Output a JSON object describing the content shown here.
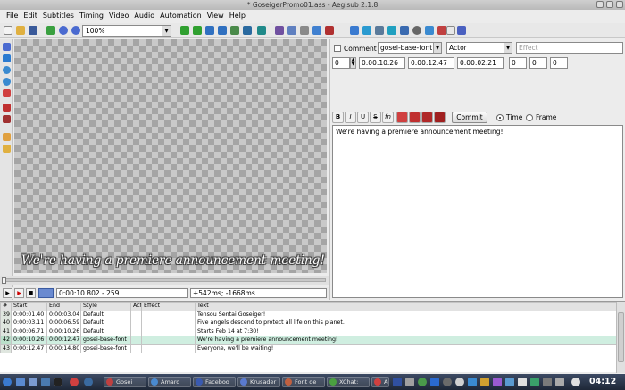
{
  "window": {
    "title": "* GoseigerPromo01.ass - Aegisub 2.1.8"
  },
  "menu": [
    "File",
    "Edit",
    "Subtitles",
    "Timing",
    "Video",
    "Audio",
    "Automation",
    "View",
    "Help"
  ],
  "toolbar": {
    "zoom_value": "100%"
  },
  "video": {
    "subtitle_text": "We're having a premiere announcement meeting!"
  },
  "video_controls": {
    "time_frame": "0:00:10.802 - 259",
    "offset": "+542ms; -1668ms"
  },
  "editor": {
    "comment_label": "Comment",
    "style": "gosei-base-font",
    "actor": "Actor",
    "effect_placeholder": "Effect",
    "layer": "0",
    "start": "0:00:10.26",
    "end": "0:00:12.47",
    "duration": "0:00:02.21",
    "margin_l": "0",
    "margin_r": "0",
    "margin_v": "0",
    "format_buttons": [
      "B",
      "I",
      "U",
      "S",
      "fn"
    ],
    "commit_label": "Commit",
    "time_label": "Time",
    "frame_label": "Frame",
    "text": "We're having a premiere announcement meeting!"
  },
  "grid": {
    "columns": [
      "#",
      "Start",
      "End",
      "Style",
      "Act",
      "Effect",
      "Text"
    ],
    "rows": [
      {
        "num": "39",
        "start": "0:00:01.40",
        "end": "0:00:03.04",
        "style": "Default",
        "actor": "",
        "effect": "",
        "text": "Tensou Sentai Goseiger!"
      },
      {
        "num": "40",
        "start": "0:00:03.11",
        "end": "0:00:06.59",
        "style": "Default",
        "actor": "",
        "effect": "",
        "text": "Five angels descend to protect all life on this planet."
      },
      {
        "num": "41",
        "start": "0:00:06.71",
        "end": "0:00:10.26",
        "style": "Default",
        "actor": "",
        "effect": "",
        "text": "Starts Feb 14 at 7:30!"
      },
      {
        "num": "42",
        "start": "0:00:10.26",
        "end": "0:00:12.47",
        "style": "gosei-base-font",
        "actor": "",
        "effect": "",
        "text": "We're having a premiere announcement meeting!"
      },
      {
        "num": "43",
        "start": "0:00:12.47",
        "end": "0:00:14.80",
        "style": "gosei-base-font",
        "actor": "",
        "effect": "",
        "text": "Everyone, we'll be waiting!"
      }
    ]
  },
  "taskbar": {
    "tasks": [
      "Gosei",
      "Amaro",
      "Faceboo",
      "Krusader",
      "Font de",
      "XChat:",
      "Aegisub"
    ],
    "clock": "04:12"
  },
  "colors": {
    "selected_row": "#cfeee0",
    "taskbar": "#2a3548"
  }
}
